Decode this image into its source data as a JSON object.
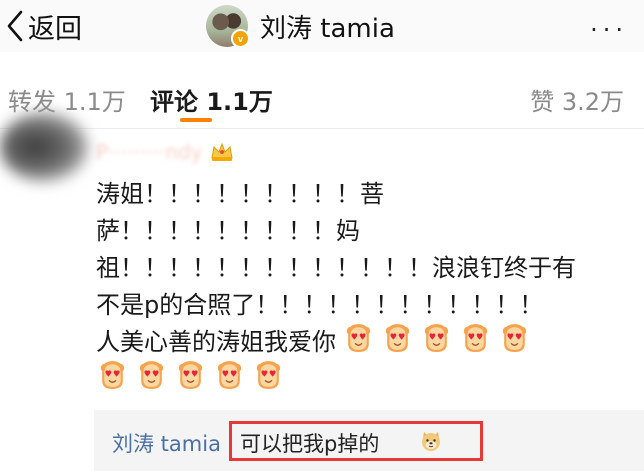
{
  "header": {
    "back_label": "返回",
    "title": "刘涛 tamia",
    "more_label": "···"
  },
  "tabs": {
    "repost": "转发 1.1万",
    "comment": "评论 1.1万",
    "like": "赞 3.2万"
  },
  "comment": {
    "author": "P·········ndy",
    "badge_icon": "crown-icon",
    "lines": [
      "涛姐！！！！！！！！！菩",
      "萨！！！！！！！！！妈",
      "祖！！！！！！！！！！！！！浪浪钉终于有",
      "不是p的合照了！！！！！！！！！！！！"
    ],
    "last_line_text": "人美心善的涛姐我爱你",
    "emoji_name": "heart-eyes-icon",
    "emoji_count_line5": 5,
    "emoji_count_line6": 5
  },
  "reply": {
    "author": "刘涛 tamia",
    "text": "可以把我p掉的",
    "emoji": "doge-icon"
  },
  "colors": {
    "accent_orange": "#ff8200",
    "link_blue": "#4a6fa5",
    "highlight_red": "#e53935"
  }
}
